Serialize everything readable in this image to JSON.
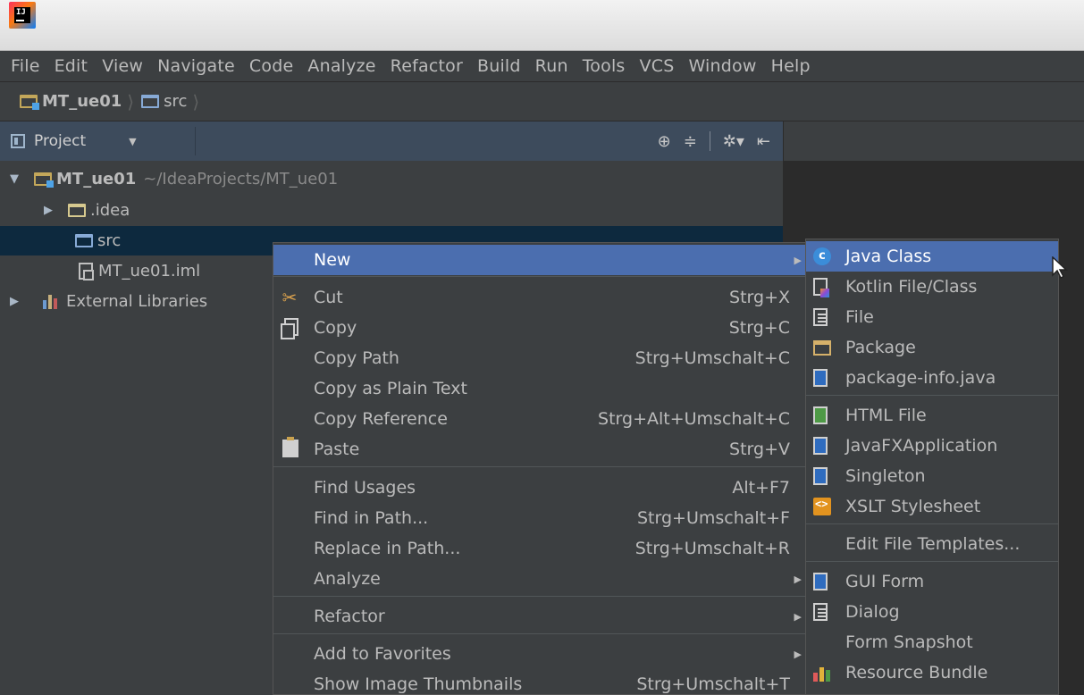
{
  "menubar": {
    "items": [
      "File",
      "Edit",
      "View",
      "Navigate",
      "Code",
      "Analyze",
      "Refactor",
      "Build",
      "Run",
      "Tools",
      "VCS",
      "Window",
      "Help"
    ]
  },
  "breadcrumb": {
    "items": [
      "MT_ue01",
      "src"
    ]
  },
  "project_panel": {
    "view_label": "Project"
  },
  "tree": {
    "root_name": "MT_ue01",
    "root_path": "~/IdeaProjects/MT_ue01",
    "items": [
      ".idea",
      "src",
      "MT_ue01.iml",
      "External Libraries"
    ]
  },
  "context_menu": {
    "items": [
      {
        "label": "New",
        "shortcut": ""
      },
      {
        "label": "Cut",
        "shortcut": "Strg+X"
      },
      {
        "label": "Copy",
        "shortcut": "Strg+C"
      },
      {
        "label": "Copy Path",
        "shortcut": "Strg+Umschalt+C"
      },
      {
        "label": "Copy as Plain Text",
        "shortcut": ""
      },
      {
        "label": "Copy Reference",
        "shortcut": "Strg+Alt+Umschalt+C"
      },
      {
        "label": "Paste",
        "shortcut": "Strg+V"
      },
      {
        "label": "Find Usages",
        "shortcut": "Alt+F7"
      },
      {
        "label": "Find in Path...",
        "shortcut": "Strg+Umschalt+F"
      },
      {
        "label": "Replace in Path...",
        "shortcut": "Strg+Umschalt+R"
      },
      {
        "label": "Analyze",
        "shortcut": ""
      },
      {
        "label": "Refactor",
        "shortcut": ""
      },
      {
        "label": "Add to Favorites",
        "shortcut": ""
      },
      {
        "label": "Show Image Thumbnails",
        "shortcut": "Strg+Umschalt+T"
      }
    ]
  },
  "submenu": {
    "items": [
      {
        "label": "Java Class",
        "icon": "java-class-icon"
      },
      {
        "label": "Kotlin File/Class",
        "icon": "kotlin-file-icon"
      },
      {
        "label": "File",
        "icon": "file-icon"
      },
      {
        "label": "Package",
        "icon": "package-icon"
      },
      {
        "label": "package-info.java",
        "icon": "package-info-icon"
      },
      {
        "label": "HTML File",
        "icon": "html-file-icon"
      },
      {
        "label": "JavaFXApplication",
        "icon": "javafx-icon"
      },
      {
        "label": "Singleton",
        "icon": "singleton-icon"
      },
      {
        "label": "XSLT Stylesheet",
        "icon": "xslt-icon"
      },
      {
        "label": "Edit File Templates...",
        "icon": ""
      },
      {
        "label": "GUI Form",
        "icon": "gui-form-icon"
      },
      {
        "label": "Dialog",
        "icon": "dialog-icon"
      },
      {
        "label": "Form Snapshot",
        "icon": ""
      },
      {
        "label": "Resource Bundle",
        "icon": "resource-bundle-icon"
      }
    ]
  },
  "colors": {
    "background": "#3c3f41",
    "selection": "#4b6eaf",
    "tree_selection": "#0d293e",
    "panel_header": "#3d4b5c"
  }
}
